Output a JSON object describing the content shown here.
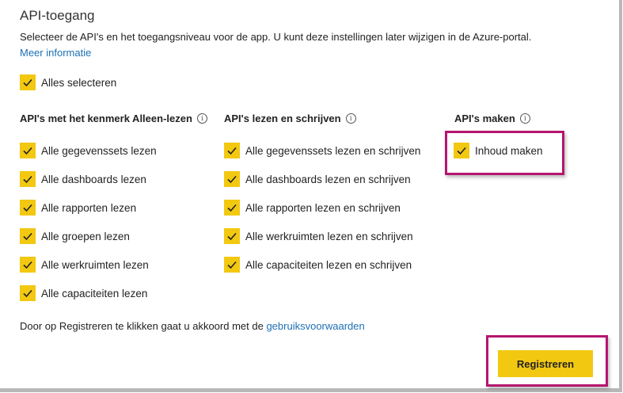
{
  "title": "API-toegang",
  "description": "Selecteer de API's en het toegangsniveau voor de app. U kunt deze instellingen later wijzigen in de Azure-portal.",
  "more_info": "Meer informatie",
  "select_all": "Alles selecteren",
  "columns": [
    {
      "heading": "API's met het kenmerk Alleen-lezen",
      "items": [
        "Alle gegevenssets lezen",
        "Alle dashboards lezen",
        "Alle rapporten lezen",
        "Alle groepen lezen",
        "Alle werkruimten lezen",
        "Alle capaciteiten lezen"
      ]
    },
    {
      "heading": "API's lezen en schrijven",
      "items": [
        "Alle gegevenssets lezen en schrijven",
        "Alle dashboards lezen en schrijven",
        "Alle rapporten lezen en schrijven",
        "Alle werkruimten lezen en schrijven",
        "Alle capaciteiten lezen en schrijven"
      ]
    },
    {
      "heading": "API's maken",
      "items": [
        "Inhoud maken"
      ]
    }
  ],
  "info_icon": "i",
  "footer": {
    "text": "Door op Registreren te klikken gaat u akkoord met de ",
    "link": "gebruiksvoorwaarden"
  },
  "register_button": "Registreren",
  "colors": {
    "accent": "#f2c811",
    "highlight": "#b5156f",
    "link": "#1e6fb5"
  }
}
